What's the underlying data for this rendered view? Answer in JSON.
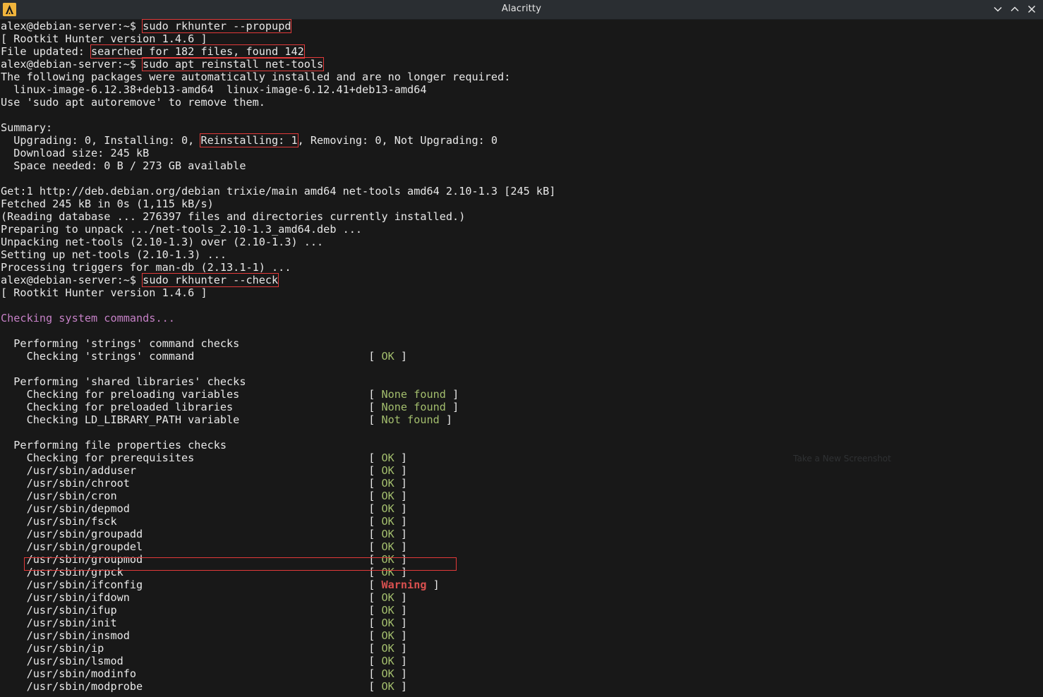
{
  "window": {
    "title": "Alacritty",
    "buttons": [
      "minimize",
      "maximize",
      "close"
    ]
  },
  "overlay_hint": "Take a New Screenshot",
  "terminal": {
    "lines": [
      [
        {
          "t": "alex@debian-server:~$ "
        },
        {
          "t": "sudo rkhunter --propupd",
          "box": true
        }
      ],
      [
        {
          "t": "[ Rootkit Hunter version 1.4.6 ]"
        }
      ],
      [
        {
          "t": "File updated: "
        },
        {
          "t": "searched for 182 files, found 142",
          "box": true
        }
      ],
      [
        {
          "t": "alex@debian-server:~$ "
        },
        {
          "t": "sudo apt reinstall net-tools",
          "box": true
        }
      ],
      [
        {
          "t": "The following packages were automatically installed and are no longer required:"
        }
      ],
      [
        {
          "t": "  linux-image-6.12.38+deb13-amd64  linux-image-6.12.41+deb13-amd64"
        }
      ],
      [
        {
          "t": "Use 'sudo apt autoremove' to remove them."
        }
      ],
      [
        {
          "t": ""
        }
      ],
      [
        {
          "t": "Summary:"
        }
      ],
      [
        {
          "t": "  Upgrading: 0, Installing: 0, "
        },
        {
          "t": "Reinstalling: 1",
          "box": true
        },
        {
          "t": ", Removing: 0, Not Upgrading: 0"
        }
      ],
      [
        {
          "t": "  Download size: 245 kB"
        }
      ],
      [
        {
          "t": "  Space needed: 0 B / 273 GB available"
        }
      ],
      [
        {
          "t": ""
        }
      ],
      [
        {
          "t": "Get:1 http://deb.debian.org/debian trixie/main amd64 net-tools amd64 2.10-1.3 [245 kB]"
        }
      ],
      [
        {
          "t": "Fetched 245 kB in 0s (1,115 kB/s)"
        }
      ],
      [
        {
          "t": "(Reading database ... 276397 files and directories currently installed.)"
        }
      ],
      [
        {
          "t": "Preparing to unpack .../net-tools_2.10-1.3_amd64.deb ..."
        }
      ],
      [
        {
          "t": "Unpacking net-tools (2.10-1.3) over (2.10-1.3) ..."
        }
      ],
      [
        {
          "t": "Setting up net-tools (2.10-1.3) ..."
        }
      ],
      [
        {
          "t": "Processing triggers for man-db (2.13.1-1) ..."
        }
      ],
      [
        {
          "t": "alex@debian-server:~$ "
        },
        {
          "t": "sudo rkhunter --check",
          "box": true
        }
      ],
      [
        {
          "t": "[ Rootkit Hunter version 1.4.6 ]"
        }
      ],
      [
        {
          "t": ""
        }
      ],
      [
        {
          "t": "Checking system commands...",
          "c": "magenta"
        }
      ],
      [
        {
          "t": ""
        }
      ],
      [
        {
          "t": "  Performing 'strings' command checks"
        }
      ],
      [
        {
          "t": "    Checking 'strings' command                           [ "
        },
        {
          "t": "OK",
          "c": "green"
        },
        {
          "t": " ]"
        }
      ],
      [
        {
          "t": ""
        }
      ],
      [
        {
          "t": "  Performing 'shared libraries' checks"
        }
      ],
      [
        {
          "t": "    Checking for preloading variables                    [ "
        },
        {
          "t": "None found",
          "c": "green"
        },
        {
          "t": " ]"
        }
      ],
      [
        {
          "t": "    Checking for preloaded libraries                     [ "
        },
        {
          "t": "None found",
          "c": "green"
        },
        {
          "t": " ]"
        }
      ],
      [
        {
          "t": "    Checking LD_LIBRARY_PATH variable                    [ "
        },
        {
          "t": "Not found",
          "c": "green"
        },
        {
          "t": " ]"
        }
      ],
      [
        {
          "t": ""
        }
      ],
      [
        {
          "t": "  Performing file properties checks"
        }
      ],
      [
        {
          "t": "    Checking for prerequisites                           [ "
        },
        {
          "t": "OK",
          "c": "green"
        },
        {
          "t": " ]"
        }
      ],
      [
        {
          "t": "    /usr/sbin/adduser                                    [ "
        },
        {
          "t": "OK",
          "c": "green"
        },
        {
          "t": " ]"
        }
      ],
      [
        {
          "t": "    /usr/sbin/chroot                                     [ "
        },
        {
          "t": "OK",
          "c": "green"
        },
        {
          "t": " ]"
        }
      ],
      [
        {
          "t": "    /usr/sbin/cron                                       [ "
        },
        {
          "t": "OK",
          "c": "green"
        },
        {
          "t": " ]"
        }
      ],
      [
        {
          "t": "    /usr/sbin/depmod                                     [ "
        },
        {
          "t": "OK",
          "c": "green"
        },
        {
          "t": " ]"
        }
      ],
      [
        {
          "t": "    /usr/sbin/fsck                                       [ "
        },
        {
          "t": "OK",
          "c": "green"
        },
        {
          "t": " ]"
        }
      ],
      [
        {
          "t": "    /usr/sbin/groupadd                                   [ "
        },
        {
          "t": "OK",
          "c": "green"
        },
        {
          "t": " ]"
        }
      ],
      [
        {
          "t": "    /usr/sbin/groupdel                                   [ "
        },
        {
          "t": "OK",
          "c": "green"
        },
        {
          "t": " ]"
        }
      ],
      [
        {
          "t": "    /usr/sbin/groupmod                                   [ "
        },
        {
          "t": "OK",
          "c": "green"
        },
        {
          "t": " ]"
        }
      ],
      [
        {
          "t": "    /usr/sbin/grpck                                      [ "
        },
        {
          "t": "OK",
          "c": "green"
        },
        {
          "t": " ]"
        }
      ],
      [
        {
          "t": "    /usr/sbin/ifconfig                                   [ "
        },
        {
          "t": "Warning",
          "c": "red"
        },
        {
          "t": " ]"
        }
      ],
      [
        {
          "t": "    /usr/sbin/ifdown                                     [ "
        },
        {
          "t": "OK",
          "c": "green"
        },
        {
          "t": " ]"
        }
      ],
      [
        {
          "t": "    /usr/sbin/ifup                                       [ "
        },
        {
          "t": "OK",
          "c": "green"
        },
        {
          "t": " ]"
        }
      ],
      [
        {
          "t": "    /usr/sbin/init                                       [ "
        },
        {
          "t": "OK",
          "c": "green"
        },
        {
          "t": " ]"
        }
      ],
      [
        {
          "t": "    /usr/sbin/insmod                                     [ "
        },
        {
          "t": "OK",
          "c": "green"
        },
        {
          "t": " ]"
        }
      ],
      [
        {
          "t": "    /usr/sbin/ip                                         [ "
        },
        {
          "t": "OK",
          "c": "green"
        },
        {
          "t": " ]"
        }
      ],
      [
        {
          "t": "    /usr/sbin/lsmod                                      [ "
        },
        {
          "t": "OK",
          "c": "green"
        },
        {
          "t": " ]"
        }
      ],
      [
        {
          "t": "    /usr/sbin/modinfo                                    [ "
        },
        {
          "t": "OK",
          "c": "green"
        },
        {
          "t": " ]"
        }
      ],
      [
        {
          "t": "    /usr/sbin/modprobe                                   [ "
        },
        {
          "t": "OK",
          "c": "green"
        },
        {
          "t": " ]"
        }
      ]
    ]
  },
  "colors": {
    "background": "#181818",
    "foreground": "#e8e8e8",
    "ok": "#a3be6d",
    "warning": "#d9504f",
    "section": "#c580c6",
    "annotation_box": "#e23a3a"
  }
}
